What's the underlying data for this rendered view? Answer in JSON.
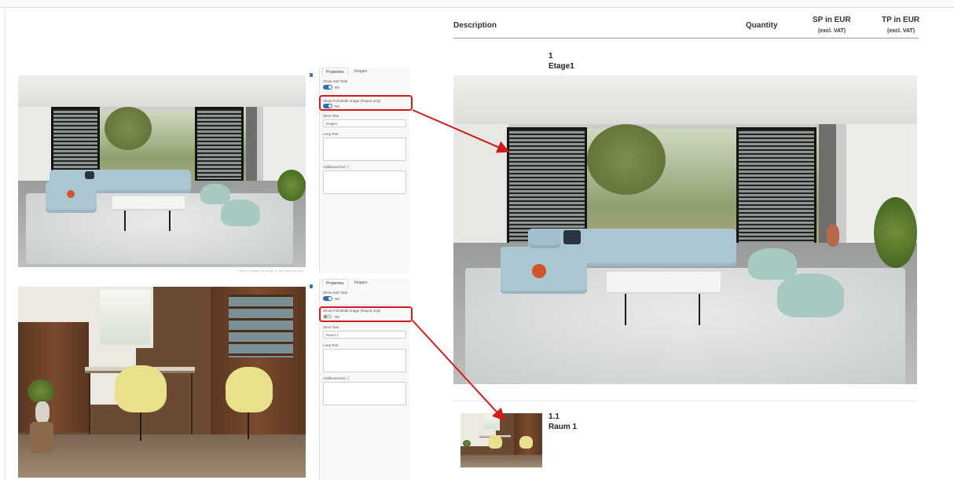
{
  "table_header": {
    "description": "Description",
    "quantity": "Quantity",
    "sp_label": "SP in EUR",
    "sp_sub": "(excl. VAT)",
    "tp_label": "TP in EUR",
    "tp_sub": "(excl. VAT)"
  },
  "panels": [
    {
      "tabs": [
        "Properties",
        "Images"
      ],
      "show_sub_total_label": "Show Sub Total",
      "show_sub_total_value": "Yes",
      "show_full_width_label": "Show Full Width Image (Report only)",
      "show_full_width_value": "Yes",
      "short_text_label": "Short Text",
      "short_text_value": "Etage1",
      "long_text_label": "Long Text",
      "additional_text_label": "Additional text ⓘ",
      "image_hint": "Click to change the image or use drag and drop"
    },
    {
      "tabs": [
        "Properties",
        "Images"
      ],
      "show_sub_total_label": "Show Sub Total",
      "show_sub_total_value": "Yes",
      "show_full_width_label": "Show Full Width Image (Report only)",
      "show_full_width_value": "Yes",
      "short_text_label": "Short Text",
      "short_text_value": "Raum 1",
      "long_text_label": "Long Text",
      "additional_text_label": "Additional text ⓘ"
    }
  ],
  "report_items": [
    {
      "number": "1",
      "title": "Etage1"
    },
    {
      "number": "1.1",
      "title": "Raum 1"
    }
  ],
  "colors": {
    "annotation_red": "#d11b1b",
    "toggle_blue": "#2a6fb8"
  }
}
